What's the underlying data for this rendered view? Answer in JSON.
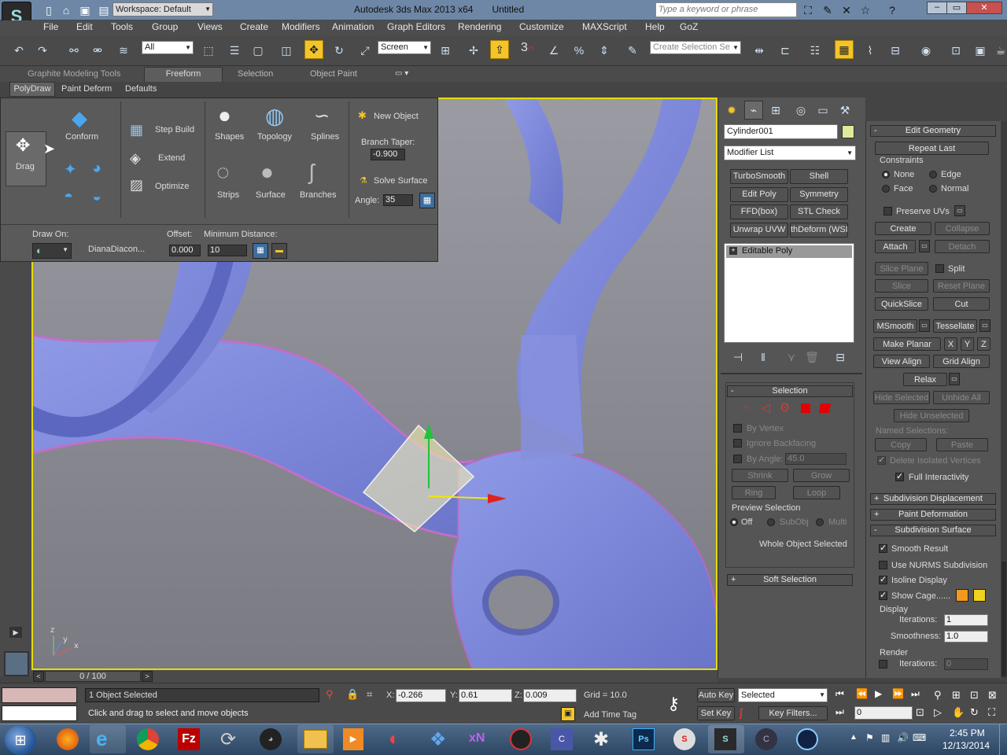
{
  "titlebar": {
    "workspace": "Workspace: Default",
    "title": "Autodesk 3ds Max  2013 x64",
    "filename": "Untitled",
    "search_placeholder": "Type a keyword or phrase"
  },
  "menu": [
    "File",
    "Edit",
    "Tools",
    "Group",
    "Views",
    "Create",
    "Modifiers",
    "Animation",
    "Graph Editors",
    "Rendering",
    "Customize",
    "MAXScript",
    "Help",
    "GoZ"
  ],
  "toolbar": {
    "filter": "All",
    "coord": "Screen",
    "snap_number": "3",
    "selection_set_placeholder": "Create Selection Se"
  },
  "ribbon": {
    "tabs": [
      "Graphite Modeling Tools",
      "Freeform",
      "Selection",
      "Object Paint"
    ],
    "subtabs": [
      "PolyDraw",
      "Paint Deform",
      "Defaults"
    ],
    "drag": "Drag",
    "conform": "Conform",
    "step_build": "Step Build",
    "extend": "Extend",
    "optimize": "Optimize",
    "shapes": "Shapes",
    "topology": "Topology",
    "splines": "Splines",
    "strips": "Strips",
    "surface": "Surface",
    "branches": "Branches",
    "new_object": "New Object",
    "branch_taper": "Branch Taper:",
    "branch_taper_val": "-0.900",
    "solve_surface": "Solve Surface",
    "angle_lbl": "Angle:",
    "angle_val": "35",
    "draw_on": "Draw On:",
    "draw_target": "DianaDiacon...",
    "offset_lbl": "Offset:",
    "offset_val": "0.000",
    "min_dist_lbl": "Minimum Distance:",
    "min_dist_val": "10"
  },
  "cmdpanel": {
    "object_name": "Cylinder001",
    "modifier_list": "Modifier List",
    "mod_buttons": [
      "TurboSmooth",
      "Shell",
      "Edit Poly",
      "Symmetry",
      "FFD(box)",
      "STL Check",
      "Unwrap UVW",
      "thDeform (WSI"
    ],
    "stack_item": "Editable Poly",
    "selection": {
      "header": "Selection",
      "by_vertex": "By Vertex",
      "ignore_backfacing": "Ignore Backfacing",
      "by_angle": "By Angle:",
      "by_angle_val": "45.0",
      "shrink": "Shrink",
      "grow": "Grow",
      "ring": "Ring",
      "loop": "Loop",
      "preview": "Preview Selection",
      "off": "Off",
      "subobj": "SubObj",
      "multi": "Multi",
      "status": "Whole Object Selected"
    },
    "soft_selection": "Soft Selection"
  },
  "editgeom": {
    "header": "Edit Geometry",
    "repeat_last": "Repeat Last",
    "constraints": "Constraints",
    "none": "None",
    "edge": "Edge",
    "face": "Face",
    "normal": "Normal",
    "preserve_uvs": "Preserve UVs",
    "create": "Create",
    "collapse": "Collapse",
    "attach": "Attach",
    "detach": "Detach",
    "slice_plane": "Slice Plane",
    "split": "Split",
    "slice": "Slice",
    "reset_plane": "Reset Plane",
    "quickslice": "QuickSlice",
    "cut": "Cut",
    "msmooth": "MSmooth",
    "tessellate": "Tessellate",
    "make_planar": "Make Planar",
    "x": "X",
    "y": "Y",
    "z": "Z",
    "view_align": "View Align",
    "grid_align": "Grid Align",
    "relax": "Relax",
    "hide_selected": "Hide Selected",
    "unhide_all": "Unhide All",
    "hide_unselected": "Hide Unselected",
    "named_selections": "Named Selections:",
    "copy": "Copy",
    "paste": "Paste",
    "delete_isolated": "Delete Isolated Vertices",
    "full_interactivity": "Full Interactivity",
    "subdiv_disp": "Subdivision Displacement",
    "paint_deform": "Paint Deformation",
    "subdiv_surface": "Subdivision Surface",
    "smooth_result": "Smooth Result",
    "use_nurms": "Use NURMS Subdivision",
    "isoline": "Isoline Display",
    "show_cage": "Show Cage......",
    "display": "Display",
    "iterations_lbl": "Iterations:",
    "iterations_val": "1",
    "smoothness_lbl": "Smoothness:",
    "smoothness_val": "1.0",
    "render": "Render",
    "render_iter_val": "0",
    "cage_color1": "#f39a1c",
    "cage_color2": "#f2d21c"
  },
  "viewport": {
    "axis_x": "x",
    "axis_y": "y",
    "axis_z": "z"
  },
  "timeline": {
    "frame": "0 / 100"
  },
  "status": {
    "selected": "1 Object Selected",
    "prompt": "Click and drag to select and move objects",
    "x_lbl": "X:",
    "x_val": "-0.266",
    "y_lbl": "Y:",
    "y_val": "0.61",
    "z_lbl": "Z:",
    "z_val": "0.009",
    "grid": "Grid = 10.0",
    "add_time_tag": "Add Time Tag",
    "auto_key": "Auto Key",
    "set_key": "Set Key",
    "selected_dd": "Selected",
    "key_filters": "Key Filters...",
    "frame_val": "0"
  },
  "taskbar": {
    "time": "2:45 PM",
    "date": "12/13/2014",
    "apps": [
      "firefox-icon",
      "ie-icon",
      "chrome-icon",
      "filezilla-icon",
      "app-icon",
      "alienware-icon",
      "explorer-icon",
      "media-icon",
      "ccleaner-icon",
      "dropbox-icon",
      "xnview-icon",
      "character-icon",
      "max-icon",
      "zbrush-icon",
      "photoshop-icon",
      "substance-icon",
      "3dsmax-icon",
      "app2-icon",
      "app3-icon"
    ]
  }
}
